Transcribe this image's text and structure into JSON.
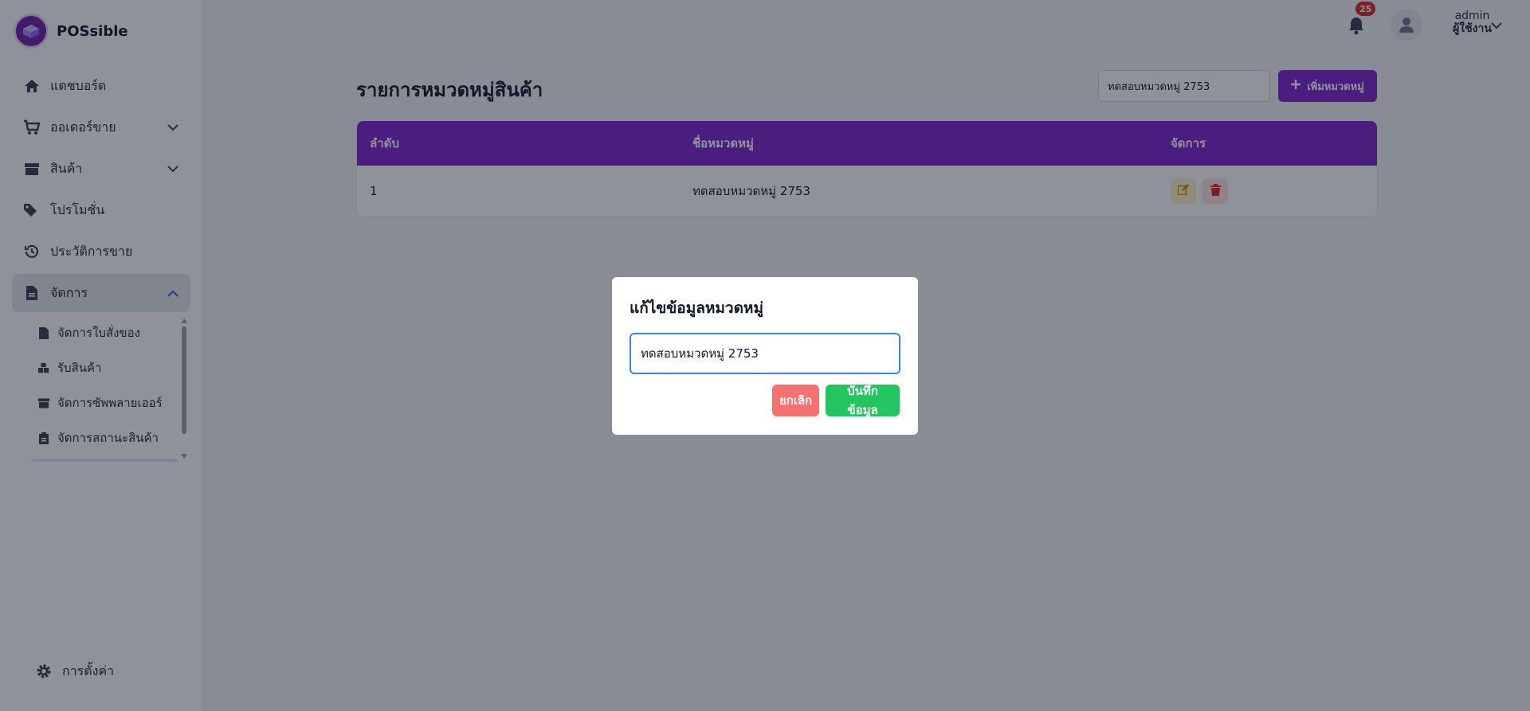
{
  "brand": {
    "name": "POSsible"
  },
  "sidebar": {
    "items": [
      {
        "label": "แดชบอร์ด",
        "icon": "home-icon"
      },
      {
        "label": "ออเดอร์ขาย",
        "icon": "cart-icon"
      },
      {
        "label": "สินค้า",
        "icon": "box-icon"
      },
      {
        "label": "โปรโมชั่น",
        "icon": "tags-icon"
      },
      {
        "label": "ประวัติการขาย",
        "icon": "history-icon"
      },
      {
        "label": "จัดการ",
        "icon": "file-icon"
      }
    ],
    "submenu": [
      {
        "label": "จัดการใบสั่งของ",
        "icon": "file-icon"
      },
      {
        "label": "รับสินค้า",
        "icon": "boxes-icon"
      },
      {
        "label": "จัดการซัพพลายเออร์",
        "icon": "box-icon"
      },
      {
        "label": "จัดการสถานะสินค้า",
        "icon": "clipboard-icon"
      }
    ],
    "settings_label": "การตั้งค่า"
  },
  "header": {
    "notification_count": "25",
    "user_name": "admin",
    "user_role": "ผู้ใช้งาน"
  },
  "main": {
    "title": "รายการหมวดหมู่สินค้า",
    "search_value": "ทดสอบหมวดหมู่ 2753",
    "add_button_label": "เพิ่มหมวดหมู่",
    "table": {
      "headers": [
        "ลำดับ",
        "ชื่อหมวดหมู่",
        "จัดการ"
      ],
      "rows": [
        {
          "index": "1",
          "name": "ทดสอบหมวดหมู่ 2753"
        }
      ]
    }
  },
  "modal": {
    "title": "แก้ไขข้อมูลหมวดหมู่",
    "input_value": "ทดสอบหมวดหมู่ 2753",
    "cancel_label": "ยกเลิก",
    "save_label": "บันทึกข้อมูล"
  },
  "colors": {
    "accent": "#7e22ce",
    "cancel": "#f87171",
    "save": "#22c55e",
    "input_focus": "#3b82f6"
  }
}
